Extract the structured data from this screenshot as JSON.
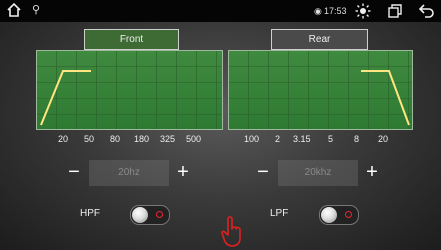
{
  "status": {
    "time": "17:53"
  },
  "tabs": {
    "front": "Front",
    "rear": "Rear"
  },
  "left_axis_ticks": [
    "20",
    "50",
    "80",
    "180",
    "325",
    "500"
  ],
  "right_axis_ticks": [
    "100",
    "2",
    "3.15",
    "5",
    "8",
    "20"
  ],
  "hpf": {
    "label": "HPF",
    "value": "20hz",
    "minus": "−",
    "plus": "+"
  },
  "lpf": {
    "label": "LPF",
    "value": "20khz",
    "minus": "−",
    "plus": "+"
  },
  "colors": {
    "graph_green": "#35803a",
    "curve_yellow": "#ffe680",
    "active_tab": "#3e6b34",
    "toggle_dot": "#e23333"
  }
}
